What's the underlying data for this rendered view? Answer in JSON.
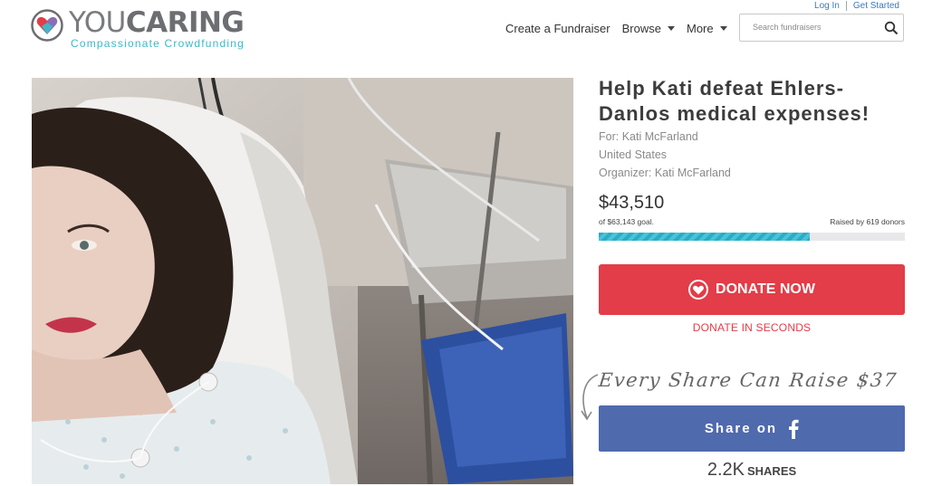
{
  "brand": {
    "name_part1": "YOU",
    "name_part2": "CARING",
    "tagline": "Compassionate Crowdfunding",
    "colors": {
      "teal": "#3db8c9",
      "red": "#e23d48",
      "facebook": "#4f6aad"
    }
  },
  "header": {
    "login_label": "Log In",
    "get_started_label": "Get Started",
    "nav": {
      "create": "Create a Fundraiser",
      "browse": "Browse",
      "more": "More"
    },
    "search": {
      "placeholder": "Search fundraisers",
      "value": "",
      "icon": "search-icon"
    }
  },
  "campaign": {
    "title": "Help Kati defeat Ehlers-Danlos medical expenses!",
    "for_line": "For: Kati McFarland",
    "location": "United States",
    "organizer_line": "Organizer: Kati McFarland",
    "raised": "$43,510",
    "goal_line": "of $63,143 goal.",
    "donors_line": "Raised by 619 donors",
    "progress_fraction": 0.69,
    "photo_icon": "campaign-photo"
  },
  "actions": {
    "donate_label": "DONATE NOW",
    "donate_seconds_label": "DONATE IN SECONDS",
    "share_prompt": "Every Share Can Raise $37",
    "share_label": "Share on",
    "shares_count": "2.2K",
    "shares_label": "SHARES"
  }
}
